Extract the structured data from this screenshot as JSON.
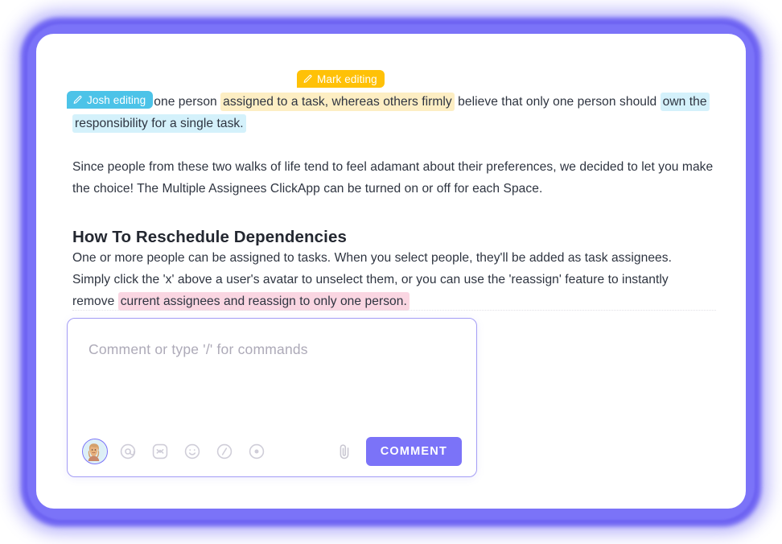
{
  "theme": {
    "glow_color": "#6c63f5",
    "accent_color": "#7b73f8",
    "highlight_blue": "#d4f1fb",
    "highlight_yellow": "#fdeec3",
    "highlight_pink": "#fad6e2",
    "tag_mark_color": "#ffc107",
    "tag_josh_color": "#4cc3e8",
    "text_color": "#2e3440"
  },
  "collaborators": [
    {
      "name": "Mark editing",
      "icon": "pencil-icon",
      "color": "#ffc107"
    },
    {
      "name": "Josh editing",
      "icon": "pencil-icon",
      "color": "#4cc3e8"
    }
  ],
  "document": {
    "paragraph_1": {
      "hidden_prefix": "ant more than one person ",
      "segment_highlight_yellow": "assigned to a task, whereas others firmly",
      "segment_plain": " believe that only one person should ",
      "segment_highlight_blue": "own the responsibility for a single task."
    },
    "paragraph_2": "Since people from these two walks of life tend to feel adamant about their preferences, we decided to let you make the choice! The Multiple Assignees ClickApp can be turned on or off for each Space.",
    "heading": "How To Reschedule Dependencies",
    "paragraph_3": {
      "plain": "One or more people can be assigned to tasks. When you select people, they'll be added as task assignees. Simply click the 'x' above a user's avatar to unselect them, or you can use the 'reassign' feature to instantly remove ",
      "highlight_pink": "current assignees and reassign to only one person."
    }
  },
  "composer": {
    "placeholder": "Comment or type '/' for commands",
    "value": "",
    "submit_label": "COMMENT",
    "tools": [
      {
        "name": "avatar",
        "label": "user-avatar"
      },
      {
        "name": "mention-icon",
        "label": "@"
      },
      {
        "name": "clickup-icon",
        "label": "ClickUp"
      },
      {
        "name": "emoji-icon",
        "label": "Emoji"
      },
      {
        "name": "slash-command-icon",
        "label": "/"
      },
      {
        "name": "record-icon",
        "label": "Record"
      },
      {
        "name": "attachment-icon",
        "label": "Attach"
      }
    ]
  }
}
